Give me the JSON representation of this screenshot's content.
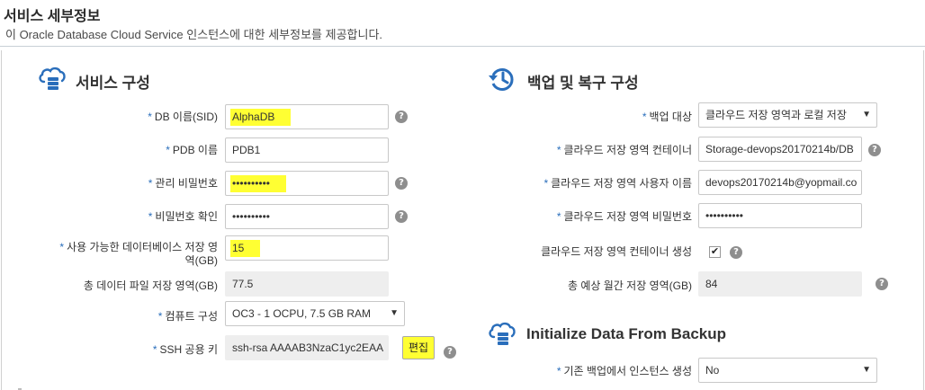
{
  "header": {
    "title": "서비스 세부정보",
    "subtitle": "이 Oracle Database Cloud Service 인스턴스에 대한 세부정보를 제공합니다."
  },
  "service_config": {
    "title": "서비스 구성",
    "icon": "cloud-database-icon",
    "fields": {
      "db_name": {
        "label": "DB 이름(SID)",
        "value": "AlphaDB",
        "required": true
      },
      "pdb_name": {
        "label": "PDB 이름",
        "value": "PDB1",
        "required": true
      },
      "admin_password": {
        "label": "관리 비밀번호",
        "value": "••••••••••",
        "required": true
      },
      "confirm_password": {
        "label": "비밀번호 확인",
        "value": "••••••••••",
        "required": true
      },
      "storage": {
        "label_line1": "사용 가능한 데이터베이스 저장 영",
        "label_line2": "역(GB)",
        "value": "15",
        "required": true
      },
      "total_storage": {
        "label": "총 데이터 파일 저장 영역(GB)",
        "value": "77.5"
      },
      "compute_shape": {
        "label": "컴퓨트 구성",
        "value": "OC3 - 1 OCPU, 7.5 GB RAM",
        "required": true
      },
      "ssh_key": {
        "label": "SSH 공용 키",
        "value": "ssh-rsa AAAAB3NzaC1yc2EAA",
        "required": true,
        "edit_label": "편집"
      }
    }
  },
  "backup_config": {
    "title": "백업 및 복구 구성",
    "icon": "clock-restore-icon",
    "fields": {
      "backup_target": {
        "label": "백업 대상",
        "value": "클라우드 저장 영역과 로컬 저장",
        "required": true
      },
      "cloud_container": {
        "label": "클라우드 저장 영역 컨테이너",
        "value": "Storage-devops20170214b/DB",
        "required": true
      },
      "cloud_user": {
        "label": "클라우드 저장 영역 사용자 이름",
        "value": "devops20170214b@yopmail.co",
        "required": true
      },
      "cloud_password": {
        "label": "클라우드 저장 영역 비밀번호",
        "value": "••••••••••",
        "required": true
      },
      "create_container": {
        "label": "클라우드 저장 영역 컨테이너 생성",
        "checked": true
      },
      "monthly_storage": {
        "label": "총 예상 월간 저장 영역(GB)",
        "value": "84"
      }
    }
  },
  "initialize": {
    "title": "Initialize Data From Backup",
    "icon": "cloud-database-icon",
    "fields": {
      "create_from_backup": {
        "label": "기존 백업에서 인스턴스 생성",
        "value": "No",
        "required": true
      }
    }
  },
  "symbols": {
    "required": "*",
    "help": "?",
    "caret": "▼",
    "check": "✔"
  },
  "colors": {
    "highlight": "#ffff33",
    "required": "#2a6ebb",
    "icon": "#2a6ebb"
  }
}
